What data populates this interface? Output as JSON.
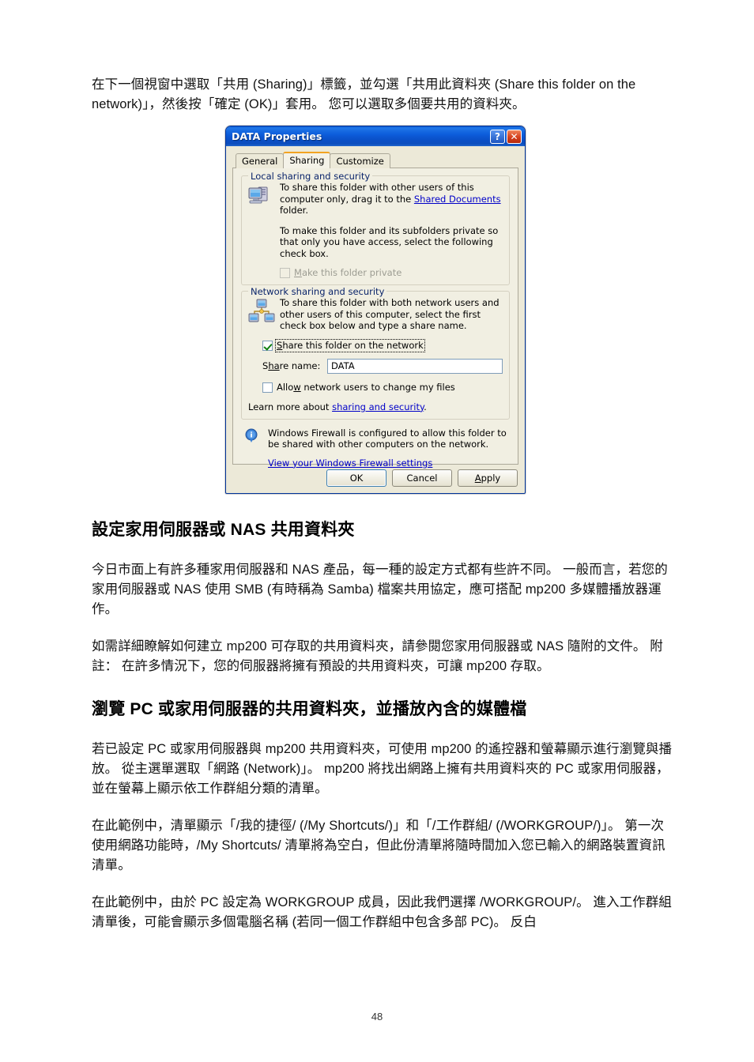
{
  "document": {
    "intro_paragraph": "在下一個視窗中選取「共用 (Sharing)」標籤，並勾選「共用此資料夾 (Share this folder on the network)」，然後按「確定 (OK)」套用。 您可以選取多個要共用的資料夾。",
    "section1_heading": "設定家用伺服器或 NAS 共用資料夾",
    "section1_para1": "今日市面上有許多種家用伺服器和 NAS 產品，每一種的設定方式都有些許不同。 一般而言，若您的家用伺服器或 NAS 使用 SMB (有時稱為 Samba) 檔案共用協定，應可搭配 mp200 多媒體播放器運作。",
    "section1_para2": "如需詳細瞭解如何建立 mp200 可存取的共用資料夾，請參閱您家用伺服器或 NAS 隨附的文件。 附註： 在許多情況下，您的伺服器將擁有預設的共用資料夾，可讓 mp200 存取。",
    "section2_heading": "瀏覽 PC 或家用伺服器的共用資料夾，並播放內含的媒體檔",
    "section2_para1": "若已設定 PC 或家用伺服器與 mp200 共用資料夾，可使用 mp200 的遙控器和螢幕顯示進行瀏覽與播放。 從主選單選取「網路 (Network)」。 mp200 將找出網路上擁有共用資料夾的 PC 或家用伺服器，並在螢幕上顯示依工作群組分類的清單。",
    "section2_para2": "在此範例中，清單顯示「/我的捷徑/ (/My Shortcuts/)」和「/工作群組/ (/WORKGROUP/)」。 第一次使用網路功能時，/My Shortcuts/ 清單將為空白，但此份清單將隨時間加入您已輸入的網路裝置資訊清單。",
    "section2_para3": "在此範例中，由於 PC 設定為 WORKGROUP 成員，因此我們選擇 /WORKGROUP/。 進入工作群組清單後，可能會顯示多個電腦名稱 (若同一個工作群組中包含多部 PC)。 反白",
    "page_number": "48"
  },
  "dialog": {
    "title": "DATA Properties",
    "titlebar_buttons": {
      "help": "?",
      "close": "✕"
    },
    "tabs": [
      {
        "label": "General",
        "active": false
      },
      {
        "label": "Sharing",
        "active": true
      },
      {
        "label": "Customize",
        "active": false
      }
    ],
    "local_group": {
      "legend": "Local sharing and security",
      "icon": "computer-icon",
      "text1_before_link": "To share this folder with other users of this computer only, drag it to the ",
      "text1_link": "Shared Documents",
      "text1_after_link": " folder.",
      "text2": "To make this folder and its subfolders private so that only you have access, select the following check box.",
      "private_checkbox": {
        "label_prefix": "M",
        "label_rest": "ake this folder private",
        "checked": false,
        "disabled": true
      }
    },
    "network_group": {
      "legend": "Network sharing and security",
      "icon": "network-computers-icon",
      "text1": "To share this folder with both network users and other users of this computer, select the first check box below and type a share name.",
      "share_checkbox": {
        "label_prefix": "S",
        "label_rest": "hare this folder on the network",
        "checked": true,
        "focused": true
      },
      "share_name_label_prefix": "S",
      "share_name_label_mid": "ha",
      "share_name_label_rest": "re name:",
      "share_name_value": "DATA",
      "allow_checkbox": {
        "label_prefix": "Allo",
        "label_accel": "w",
        "label_rest": " network users to change my files",
        "checked": false
      },
      "learn_more_prefix": "Learn more about ",
      "learn_more_link": "sharing and security",
      "learn_more_suffix": "."
    },
    "firewall_notice": {
      "icon": "info-icon",
      "text": "Windows Firewall is configured to allow this folder to be shared with other computers on the network.",
      "link": "View your Windows Firewall settings"
    },
    "buttons": {
      "ok": "OK",
      "cancel": "Cancel",
      "apply_accel": "A",
      "apply_rest": "pply"
    },
    "colors": {
      "titlebar_blue": "#0a4fc6",
      "active_tab_accent": "#f2a322",
      "dialog_face": "#ece9d8",
      "panel_face": "#f1efe2",
      "link": "#0000c8",
      "legend_text": "#0a246a",
      "check_green": "#108010"
    }
  }
}
